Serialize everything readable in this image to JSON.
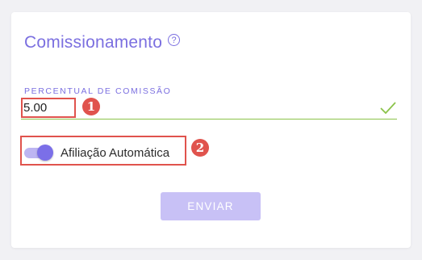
{
  "card": {
    "title": "Comissionamento",
    "help_icon_glyph": "?",
    "help_icon": "question-circle-icon"
  },
  "commission_field": {
    "label": "PERCENTUAL DE COMISSÃO",
    "value": "5.00",
    "valid": true,
    "valid_icon": "check-icon",
    "valid_color": "#8bc34a"
  },
  "auto_affiliation": {
    "label": "Afiliação Automática",
    "enabled": true
  },
  "submit": {
    "label": "ENVIAR",
    "disabled": true
  },
  "annotations": {
    "highlight_color": "#e0534d",
    "badge_1": "1",
    "badge_2": "2"
  },
  "theme": {
    "accent": "#7b6fe0",
    "toggle_track": "#bdb5f2",
    "button_disabled": "#c8c1f6"
  }
}
